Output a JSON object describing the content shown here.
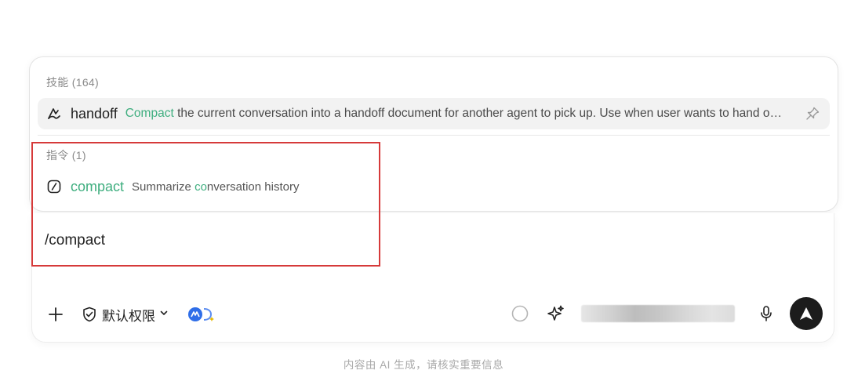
{
  "popup": {
    "skills_label": "技能 (164)",
    "skill": {
      "name": "handoff",
      "desc_highlight": "Compact",
      "desc_rest": " the current conversation into a handoff document for another agent to pick up. Use when user wants to hand off work to another agent or continue later."
    },
    "commands_label": "指令 (1)",
    "command": {
      "name": "compact",
      "desc_before": "Summarize ",
      "desc_highlight": "co",
      "desc_after": "nversation history"
    }
  },
  "composer": {
    "input_value": "/compact",
    "permission_label": "默认权限"
  },
  "disclaimer": "内容由 AI 生成，请核实重要信息",
  "colors": {
    "highlight": "#3fae7f",
    "annotation": "#d63a3a",
    "send_button": "#1c1c1c"
  },
  "icons": {
    "skill": "signature-icon",
    "command": "slash-command-icon",
    "pin": "pin-icon",
    "add": "plus-icon",
    "permission": "shield-check-icon",
    "model": "model-badge-icon",
    "status": "circle-icon",
    "enhance": "sparkle-icon",
    "voice": "microphone-icon",
    "send": "send-arrow-icon"
  }
}
